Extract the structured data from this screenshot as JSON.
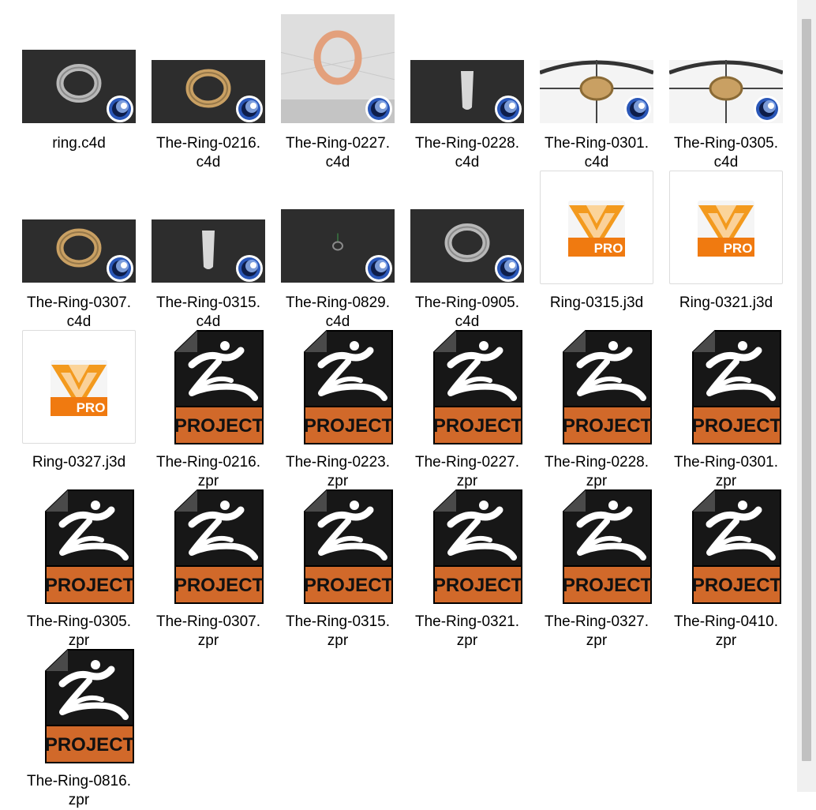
{
  "files": [
    {
      "name": "ring.c4d",
      "type": "c4d",
      "style": "plain"
    },
    {
      "name": "The-Ring-0216.\nc4d",
      "type": "c4d",
      "style": "gold"
    },
    {
      "name": "The-Ring-0227.\nc4d",
      "type": "c4d",
      "style": "light"
    },
    {
      "name": "The-Ring-0228.\nc4d",
      "type": "c4d",
      "style": "side"
    },
    {
      "name": "The-Ring-0301.\nc4d",
      "type": "c4d",
      "style": "view"
    },
    {
      "name": "The-Ring-0305.\nc4d",
      "type": "c4d",
      "style": "view"
    },
    {
      "name": "The-Ring-0307.\nc4d",
      "type": "c4d",
      "style": "gold"
    },
    {
      "name": "The-Ring-0315.\nc4d",
      "type": "c4d",
      "style": "side"
    },
    {
      "name": "The-Ring-0829.\nc4d",
      "type": "c4d",
      "style": "tiny"
    },
    {
      "name": "The-Ring-0905.\nc4d",
      "type": "c4d",
      "style": "plain"
    },
    {
      "name": "Ring-0315.j3d",
      "type": "j3d"
    },
    {
      "name": "Ring-0321.j3d",
      "type": "j3d"
    },
    {
      "name": "Ring-0327.j3d",
      "type": "j3d"
    },
    {
      "name": "The-Ring-0216.\nzpr",
      "type": "zpr"
    },
    {
      "name": "The-Ring-0223.\nzpr",
      "type": "zpr"
    },
    {
      "name": "The-Ring-0227.\nzpr",
      "type": "zpr"
    },
    {
      "name": "The-Ring-0228.\nzpr",
      "type": "zpr"
    },
    {
      "name": "The-Ring-0301.\nzpr",
      "type": "zpr"
    },
    {
      "name": "The-Ring-0305.\nzpr",
      "type": "zpr"
    },
    {
      "name": "The-Ring-0307.\nzpr",
      "type": "zpr"
    },
    {
      "name": "The-Ring-0315.\nzpr",
      "type": "zpr"
    },
    {
      "name": "The-Ring-0321.\nzpr",
      "type": "zpr"
    },
    {
      "name": "The-Ring-0327.\nzpr",
      "type": "zpr"
    },
    {
      "name": "The-Ring-0410.\nzpr",
      "type": "zpr"
    },
    {
      "name": "The-Ring-0816.\nzpr",
      "type": "zpr"
    }
  ],
  "badges": {
    "project_label": "PROJECT",
    "pro_label": "PRO"
  },
  "colors": {
    "zpr_body": "#171717",
    "zpr_band": "#d1692a",
    "j3d_orange": "#f39a1e",
    "c4d_blue": "#2a57b8",
    "viewport": "#2d2d2d",
    "gold": "#c9a063",
    "silver": "#b8b8b8"
  }
}
